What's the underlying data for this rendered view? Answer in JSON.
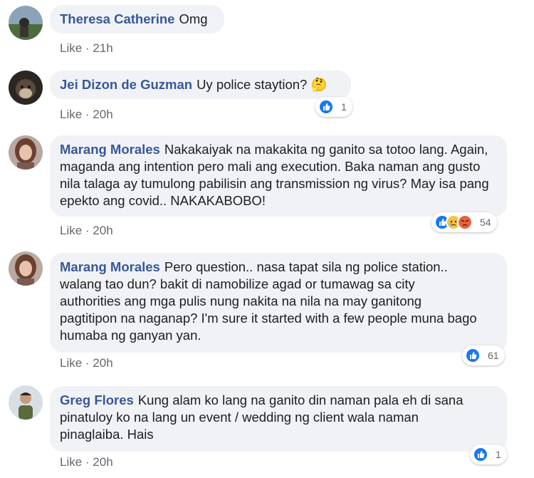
{
  "comments": [
    {
      "author": "Theresa Catherine",
      "text": "Omg",
      "like": "Like",
      "time": "21h"
    },
    {
      "author": "Jei Dizon de Guzman",
      "text": "Uy police staytion? ",
      "emoji": "🤔",
      "like": "Like",
      "time": "20h",
      "reaction_count": "1"
    },
    {
      "author": "Marang Morales",
      "text": "Nakakaiyak na makakita ng ganito sa totoo lang. Again, maganda ang intention pero mali ang execution. Baka naman ang gusto nila talaga ay tumulong pabilisin ang transmission ng virus? May isa pang epekto ang covid.. NAKAKABOBO!",
      "like": "Like",
      "time": "20h",
      "reaction_count": "54"
    },
    {
      "author": "Marang Morales",
      "text": "Pero question.. nasa tapat sila ng police station.. walang tao dun? bakit di namobilize agad or tumawag sa city authorities ang mga pulis nung nakita na nila na may ganitong pagtitipon na naganap? I'm sure it started with a few people muna bago humaba ng ganyan yan.",
      "like": "Like",
      "time": "20h",
      "reaction_count": "61"
    },
    {
      "author": "Greg Flores",
      "text": "Kung alam ko lang na ganito din naman pala eh di sana pinatuloy ko na lang un event / wedding ng client wala naman pinaglaiba. Hais",
      "like": "Like",
      "time": "20h",
      "reaction_count": "1"
    }
  ],
  "separator": " · ",
  "icons": {
    "like": "like-reaction-icon",
    "sad": "sad-reaction-icon",
    "angry": "angry-reaction-icon"
  },
  "colors": {
    "author": "#385898",
    "bubble": "#f0f2f5",
    "like_blue": "#1877f2",
    "meta": "#65676b"
  }
}
